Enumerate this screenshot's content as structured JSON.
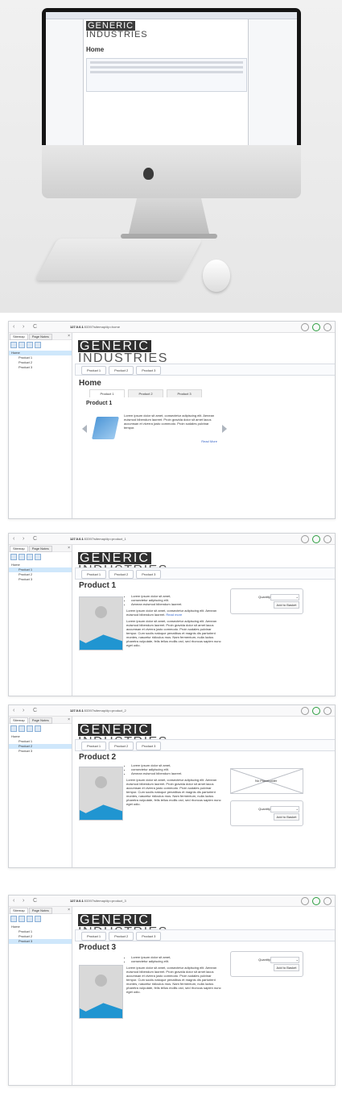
{
  "hero": {
    "screen_logo_top": "GENERIC",
    "screen_logo_bottom": "INDUSTRIES",
    "screen_title": "Home"
  },
  "browsers": [
    {
      "url_host": "127.0.0.1",
      "url_path": ":53397/sitemap/#p=home",
      "page_title": "Home",
      "product_heading": "Product 1",
      "home_tabs": [
        "Product 1",
        "Product 2",
        "Product 3"
      ],
      "carousel_text": "Lorem ipsum dolor sit amet, consectetur adipiscing elit. Aenean euismod bibendum laoreet. Proin gravida dolor sit amet lacus accumsan et viverra justo commodo. Proin sodales pulvinar tempor.",
      "read_more": "Read More"
    },
    {
      "url_host": "127.0.0.1",
      "url_path": ":53397/sitemap/#p=product_1",
      "page_title": "Product 1",
      "bullets": [
        "Lorem ipsum dolor sit amet,",
        "consectetur adipiscing elit.",
        "Aenean euismod bibendum laoreet."
      ],
      "paragraph_1": "Lorem ipsum dolor sit amet, consectetur adipiscing elit. Aenean euismod bibendum laoreet.",
      "read_more": "Read more",
      "paragraph_2": "Lorem ipsum dolor sit amet, consectetur adipiscing elit. Aenean euismod bibendum laoreet. Proin gravida dolor sit amet lacus accumsan et viverra justo commodo. Proin sodales pulvinar tempor. Cum sociis natoque penatibus et magnis dis parturient montes, nascetur ridiculus mus. Nam fermentum, nulla luctus pharetra vulputate, felis tellus mollis orci, sed rhoncus sapien nunc eget odio.",
      "quantity": "Quantity",
      "add_to_basket": "Add to Basket"
    },
    {
      "url_host": "127.0.0.1",
      "url_path": ":53397/sitemap/#p=product_2",
      "page_title": "Product 2",
      "bullets": [
        "Lorem ipsum dolor sit amet,",
        "consectetur adipiscing elit.",
        "Aenean euismod bibendum laoreet."
      ],
      "paragraph_1": "Lorem ipsum dolor sit amet, consectetur adipiscing elit. Aenean euismod bibendum laoreet. Proin gravida dolor sit amet lacus accumsan et viverra justo commodo. Proin sodales pulvinar tempor. Cum sociis natoque penatibus et magnis dis parturient montes, nascetur ridiculus mus. Nam fermentum, nulla luctus pharetra vulputate, felis tellus mollis orci, sed rhoncus sapien nunc eget odio.",
      "placeholder": "No Placeholder",
      "quantity": "Quantity",
      "add_to_basket": "Add to Basket"
    },
    {
      "url_host": "127.0.0.1",
      "url_path": ":53397/sitemap/#p=product_3",
      "page_title": "Product 3",
      "bullets": [
        "Lorem ipsum dolor sit amet,",
        "consectetur adipiscing elit."
      ],
      "paragraph_1": "Lorem ipsum dolor sit amet, consectetur adipiscing elit. Aenean euismod bibendum laoreet. Proin gravida dolor sit amet lacus accumsan et viverra justo commodo. Proin sodales pulvinar tempor. Cum sociis natoque penatibus et magnis dis parturient montes, nascetur ridiculus mus. Nam fermentum, nulla luctus pharetra vulputate, felis tellus mollis orci, sed rhoncus sapien nunc eget odio.",
      "quantity": "Quantity",
      "add_to_basket": "Add to Basket"
    }
  ],
  "shared": {
    "sidebar_tabs": [
      "Sitemap",
      "Page Notes"
    ],
    "tree": [
      "Home",
      "Product 1",
      "Product 2",
      "Product 3"
    ],
    "logo_top": "GENERIC",
    "logo_bottom": "INDUSTRIES",
    "nav": [
      "Product 1",
      "Product 2",
      "Product 3"
    ],
    "close_icon": "×",
    "back_icon": "‹",
    "forward_icon": "›",
    "reload_icon": "C"
  },
  "icons": [
    "home-icon",
    "search-icon",
    "gear-icon",
    "download-icon"
  ]
}
